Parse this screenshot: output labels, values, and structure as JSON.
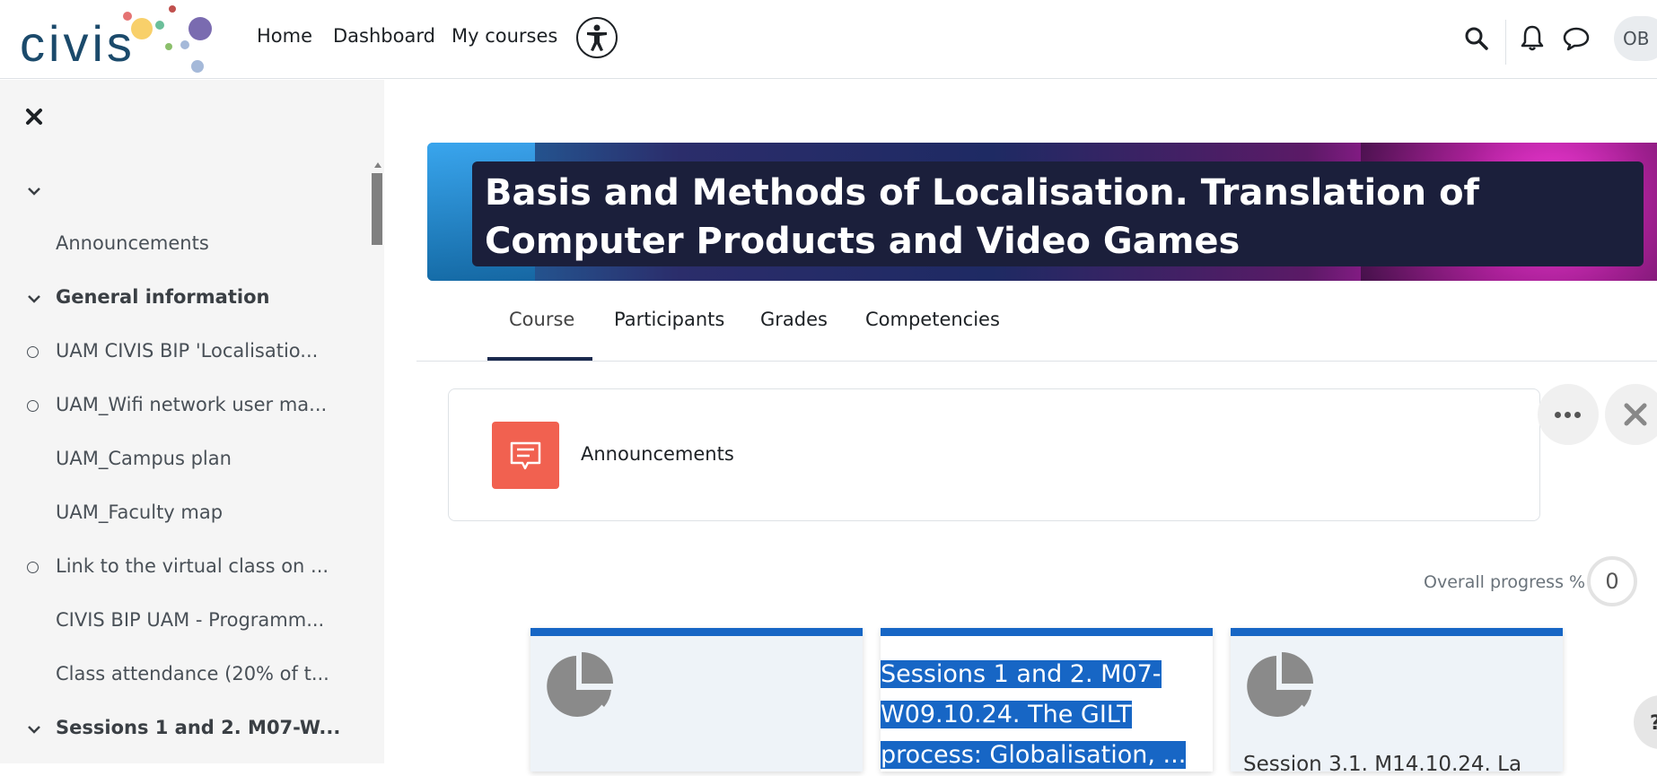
{
  "brand": {
    "logo_text": "civis"
  },
  "nav": {
    "links": [
      "Home",
      "Dashboard",
      "My courses"
    ],
    "avatar_initials": "OB"
  },
  "drawer": {
    "items": [
      {
        "label": "",
        "type": "section-collapse"
      },
      {
        "label": "Announcements",
        "type": "activity"
      },
      {
        "label": "General information",
        "type": "section"
      },
      {
        "label": "UAM CIVIS BIP 'Localisatio...",
        "type": "activity-check"
      },
      {
        "label": "UAM_Wifi network user ma...",
        "type": "activity-check"
      },
      {
        "label": "UAM_Campus plan",
        "type": "activity"
      },
      {
        "label": "UAM_Faculty map",
        "type": "activity"
      },
      {
        "label": "Link to the virtual class on ...",
        "type": "activity-check"
      },
      {
        "label": "CIVIS BIP UAM - Programm...",
        "type": "activity"
      },
      {
        "label": "Class attendance (20% of t...",
        "type": "activity"
      },
      {
        "label": "Sessions 1 and 2. M07-W...",
        "type": "section"
      }
    ]
  },
  "course": {
    "title": "Basis and Methods of Localisation. Translation of Computer Products and Video Games"
  },
  "tabs": [
    "Course",
    "Participants",
    "Grades",
    "Competencies"
  ],
  "announcements": {
    "label": "Announcements"
  },
  "progress": {
    "label": "Overall progress %",
    "value": "0"
  },
  "tiles": [
    {
      "text": ""
    },
    {
      "text": " Sessions 1 and 2. M07-W09.10.24. The GILT process: Globalisation, ..."
    },
    {
      "text": "Session 3.1. M14.10.24. La"
    }
  ],
  "colors": {
    "accent": "#1766c5",
    "announce": "#f16150",
    "drawer_bg": "#f5f5f5",
    "title_bg": "#1b1f3b"
  }
}
